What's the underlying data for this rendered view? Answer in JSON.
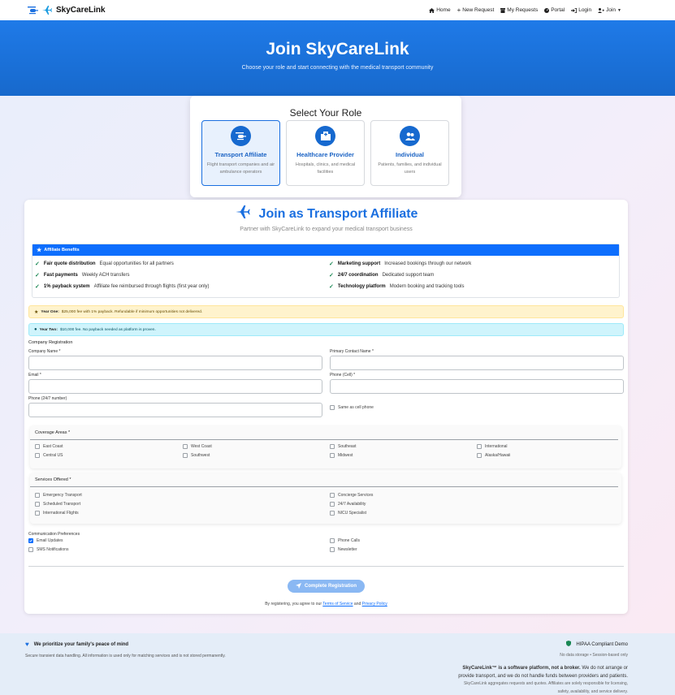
{
  "nav": {
    "brand": "SkyCareLink",
    "links": [
      {
        "label": "Home",
        "icon": "home-icon"
      },
      {
        "label": "New Request",
        "icon": "plus-icon"
      },
      {
        "label": "My Requests",
        "icon": "archive-icon"
      },
      {
        "label": "Portal",
        "icon": "gauge-icon"
      },
      {
        "label": "Login",
        "icon": "login-icon"
      },
      {
        "label": "Join",
        "icon": "user-plus-icon"
      }
    ]
  },
  "hero": {
    "title": "Join SkyCareLink",
    "subtitle": "Choose your role and start connecting with the medical transport community"
  },
  "role_select": {
    "title": "Select Your Role",
    "roles": [
      {
        "title": "Transport Affiliate",
        "desc": "Flight transport companies and air ambulance operators",
        "icon": "helicopter-icon",
        "active": true
      },
      {
        "title": "Healthcare Provider",
        "desc": "Hospitals, clinics, and medical facilities",
        "icon": "hospital-icon",
        "active": false
      },
      {
        "title": "Individual",
        "desc": "Patients, families, and individual users",
        "icon": "users-icon",
        "active": false
      }
    ]
  },
  "form": {
    "title": "Join as Transport Affiliate",
    "subtitle": "Partner with SkyCareLink to expand your medical transport business",
    "benefits_heading": "Affiliate Benefits",
    "benefits": [
      {
        "bold": "Fair quote distribution",
        "text": "Equal opportunities for all partners"
      },
      {
        "bold": "Marketing support",
        "text": "Increased bookings through our network"
      },
      {
        "bold": "Fast payments",
        "text": "Weekly ACH transfers"
      },
      {
        "bold": "24/7 coordination",
        "text": "Dedicated support team"
      },
      {
        "bold": "1% payback system",
        "text": "Affiliate fee reimbursed through flights (first year only)"
      },
      {
        "bold": "Technology platform",
        "text": "Modern booking and tracking tools"
      }
    ],
    "year_one_label": "Year One:",
    "year_one_text": "$25,000 fee with 1% payback. Refundable if minimum opportunities not delivered.",
    "year_two_label": "Year Two:",
    "year_two_text": "$10,000 fee. No payback needed as platform is proven.",
    "section_title": "Company Registration",
    "fields": {
      "company_name": "Company Name *",
      "primary_contact": "Primary Contact Name *",
      "email": "Email *",
      "phone_cell": "Phone (Cell) *",
      "phone_247": "Phone (24/7 number)",
      "same_as_cell": "Same as cell phone"
    },
    "coverage": {
      "title": "Coverage Areas *",
      "options": [
        "East Coast",
        "West Coast",
        "Southeast",
        "International",
        "Central US",
        "Southwest",
        "Midwest",
        "Alaska/Hawaii"
      ]
    },
    "services": {
      "title": "Services Offered *",
      "options": [
        "Emergency Transport",
        "Concierge Services",
        "Scheduled Transport",
        "24/7 Availability",
        "International Flights",
        "NICU Specialist"
      ]
    },
    "comm": {
      "title": "Communication Preferences",
      "options": [
        {
          "label": "Email Updates",
          "checked": true
        },
        {
          "label": "Phone Calls",
          "checked": false
        },
        {
          "label": "SMS Notifications",
          "checked": false
        },
        {
          "label": "Newsletter",
          "checked": false
        }
      ]
    },
    "submit_label": "Complete Registration",
    "terms_prefix": "By registering, you agree to our",
    "terms_link": "Terms of Service",
    "terms_and": "and",
    "privacy_link": "Privacy Policy"
  },
  "footer": {
    "left_title": "We prioritize your family's peace of mind",
    "left_sub": "Secure transient data handling. All information is used only for matching services and is not stored permanently.",
    "right_title": "HIPAA Compliant Demo",
    "right_sub": "No data storage • Session-based only",
    "para_bold": "SkyCareLink™ is a software platform, not a broker.",
    "para_rest": "We do not arrange or",
    "para_line2": "provide transport, and we do not handle funds between providers and patients.",
    "para_small1": "SkyCareLink aggregates requests and quotes. Affiliates are solely responsible for licensing,",
    "para_small2": "safety, availability, and service delivery."
  },
  "colors": {
    "primary": "#1a6fe0",
    "hero": "#1769cc",
    "success": "#198754"
  }
}
